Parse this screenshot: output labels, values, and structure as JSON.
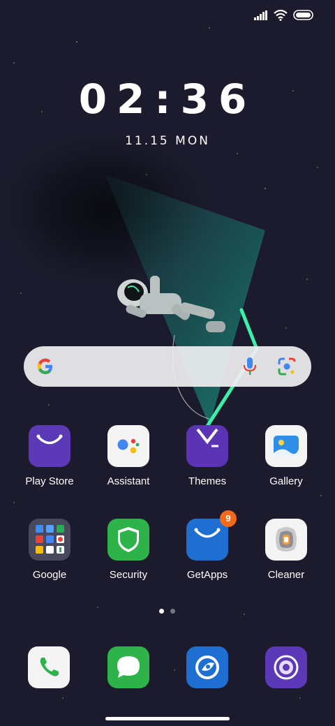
{
  "clock": {
    "time": "02:36",
    "date": "11.15  MON"
  },
  "search": {
    "engine": "Google",
    "voice_icon": "mic-icon",
    "lens_icon": "lens-icon"
  },
  "apps_row1": [
    {
      "label": "Play Store",
      "icon": "play-store-icon"
    },
    {
      "label": "Assistant",
      "icon": "assistant-icon"
    },
    {
      "label": "Themes",
      "icon": "themes-icon"
    },
    {
      "label": "Gallery",
      "icon": "gallery-icon"
    }
  ],
  "apps_row2": [
    {
      "label": "Google",
      "icon": "google-folder-icon"
    },
    {
      "label": "Security",
      "icon": "security-icon"
    },
    {
      "label": "GetApps",
      "icon": "getapps-icon",
      "badge": "9"
    },
    {
      "label": "Cleaner",
      "icon": "cleaner-icon"
    }
  ],
  "dock": [
    {
      "icon": "phone-icon"
    },
    {
      "icon": "messages-icon"
    },
    {
      "icon": "browser-icon"
    },
    {
      "icon": "camera-icon"
    }
  ],
  "page_indicator": {
    "pages": 2,
    "current": 1
  },
  "colors": {
    "accent_purple": "#5c3ab7",
    "green": "#2db34a",
    "blue": "#1f6fd3",
    "badge": "#f36a1d"
  }
}
